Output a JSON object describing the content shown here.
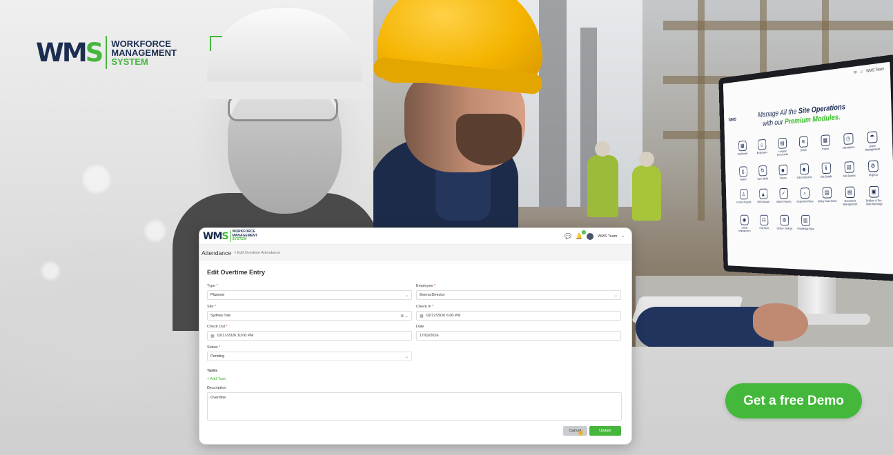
{
  "brand": {
    "mark_part1": "W",
    "mark_part2": "M",
    "mark_part3": "S",
    "line1": "WORKFORCE",
    "line2": "MANAGEMENT",
    "line3": "SYSTEM"
  },
  "monitor": {
    "user": "WMS Team",
    "headline_part1": "Manage All the ",
    "headline_bold": "Site Operations",
    "headline_part2": "with our ",
    "headline_green": "Premium Modules.",
    "modules": [
      {
        "label": "Dashboard",
        "icon": "dashboard-icon"
      },
      {
        "label": "Employees",
        "icon": "employees-icon"
      },
      {
        "label": "Hospital Documents",
        "icon": "documents-icon"
      },
      {
        "label": "Bunch",
        "icon": "layers-icon"
      },
      {
        "label": "Roster",
        "icon": "calendar-icon"
      },
      {
        "label": "Attendance",
        "icon": "clock-icon"
      },
      {
        "label": "Leave Management",
        "icon": "umbrella-icon"
      },
      {
        "label": "Payroll",
        "icon": "payroll-icon"
      },
      {
        "label": "Open Shifts",
        "icon": "shift-icon"
      },
      {
        "label": "Clients",
        "icon": "clients-icon"
      },
      {
        "label": "Subcontractors",
        "icon": "subcontractor-icon"
      },
      {
        "label": "Site Details",
        "icon": "info-icon"
      },
      {
        "label": "Site Diaries",
        "icon": "diary-icon"
      },
      {
        "label": "Projects",
        "icon": "projects-icon"
      },
      {
        "label": "Incident Reports",
        "icon": "warning-icon"
      },
      {
        "label": "WHS Boards",
        "icon": "board-icon"
      },
      {
        "label": "SWMS Reports",
        "icon": "checklist-icon"
      },
      {
        "label": "Inspection Plans",
        "icon": "search-icon"
      },
      {
        "label": "Safety Data Sheet",
        "icon": "sheet-icon"
      },
      {
        "label": "Document Management",
        "icon": "file-icon"
      },
      {
        "label": "Toolbox & Pre-Start Meetings",
        "icon": "toolbox-icon"
      },
      {
        "label": "Assets Management",
        "icon": "asset-icon"
      },
      {
        "label": "Help Desk",
        "icon": "headset-icon"
      },
      {
        "label": "System Settings",
        "icon": "gear-icon"
      },
      {
        "label": "Knowledge Base",
        "icon": "book-icon"
      }
    ]
  },
  "app": {
    "logo_mark": "WMS",
    "logo_line1": "WORKFORCE",
    "logo_line2": "MANAGEMENT",
    "logo_line3": "SYSTEM",
    "notif_count": "1",
    "user": "WMS Team",
    "breadcrumb_main": "Attendance",
    "breadcrumb_sub": "> Edit Overtime Attendance",
    "form_title": "Edit Overtime Entry",
    "fields": {
      "type_label": "Type",
      "type_value": "Planned",
      "employee_label": "Employee",
      "employee_value": "Emma Director",
      "site_label": "Site",
      "site_value": "Sydney Site",
      "checkin_label": "Check In",
      "checkin_value": "02/17/2026 6:00 PM",
      "checkout_label": "Check Out",
      "checkout_value": "02/17/2026 10:00 PM",
      "date_label": "Date",
      "date_value": "17/02/2026",
      "status_label": "Status",
      "status_value": "Pending",
      "tasks_label": "Tasks",
      "add_task": "+ Add Task",
      "description_label": "Description",
      "description_value": "Overtime"
    },
    "cancel_label": "Cancel",
    "update_label": "Update"
  },
  "cta": {
    "label": "Get a free Demo"
  },
  "colors": {
    "brand_navy": "#1c2d52",
    "brand_green": "#46b63c",
    "helmet_yellow": "#f4b400"
  }
}
